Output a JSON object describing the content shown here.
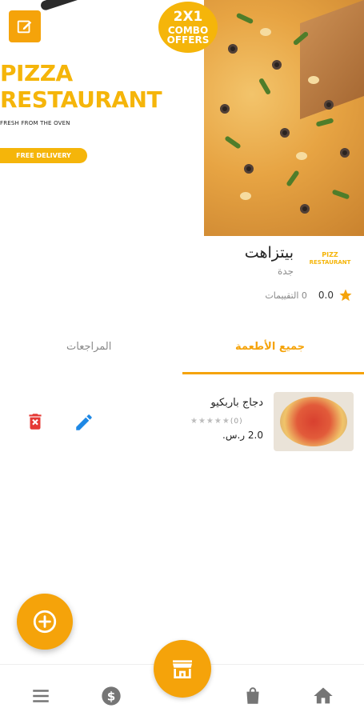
{
  "banner": {
    "combo_line1": "2X1",
    "combo_line2": "COMBO",
    "combo_line3": "OFFERS",
    "title_line1": "PIZZA",
    "title_line2": "RESTAURANT",
    "subtitle": "FRESH FROM THE OVEN",
    "delivery": "FREE DELIVERY"
  },
  "restaurant": {
    "logo_line1": "PIZZ",
    "logo_line2": "RESTAURANT",
    "name": "بيتزاهت",
    "city": "جدة",
    "rating": "0.0",
    "ratings_count": "0 التقييمات"
  },
  "tabs": {
    "all_foods": "جميع الأطعمة",
    "reviews": "المراجعات"
  },
  "items": [
    {
      "name": "دجاج باربكيو",
      "stars": "★★★★★",
      "reviews_count": "(0)",
      "price": "2.0 ر.س."
    }
  ],
  "colors": {
    "accent": "#f5a30a",
    "brand_yellow": "#f5b50a",
    "edit_blue": "#1e88e5",
    "delete_red": "#e53935"
  },
  "icons": {
    "edit_banner": "edit-square-icon",
    "star": "star-icon",
    "item_edit": "pencil-icon",
    "item_delete": "trash-icon",
    "fab": "add-circle-icon",
    "nav_menu": "menu-icon",
    "nav_money": "dollar-icon",
    "nav_store": "store-icon",
    "nav_bag": "shopping-bag-icon",
    "nav_home": "home-icon"
  }
}
